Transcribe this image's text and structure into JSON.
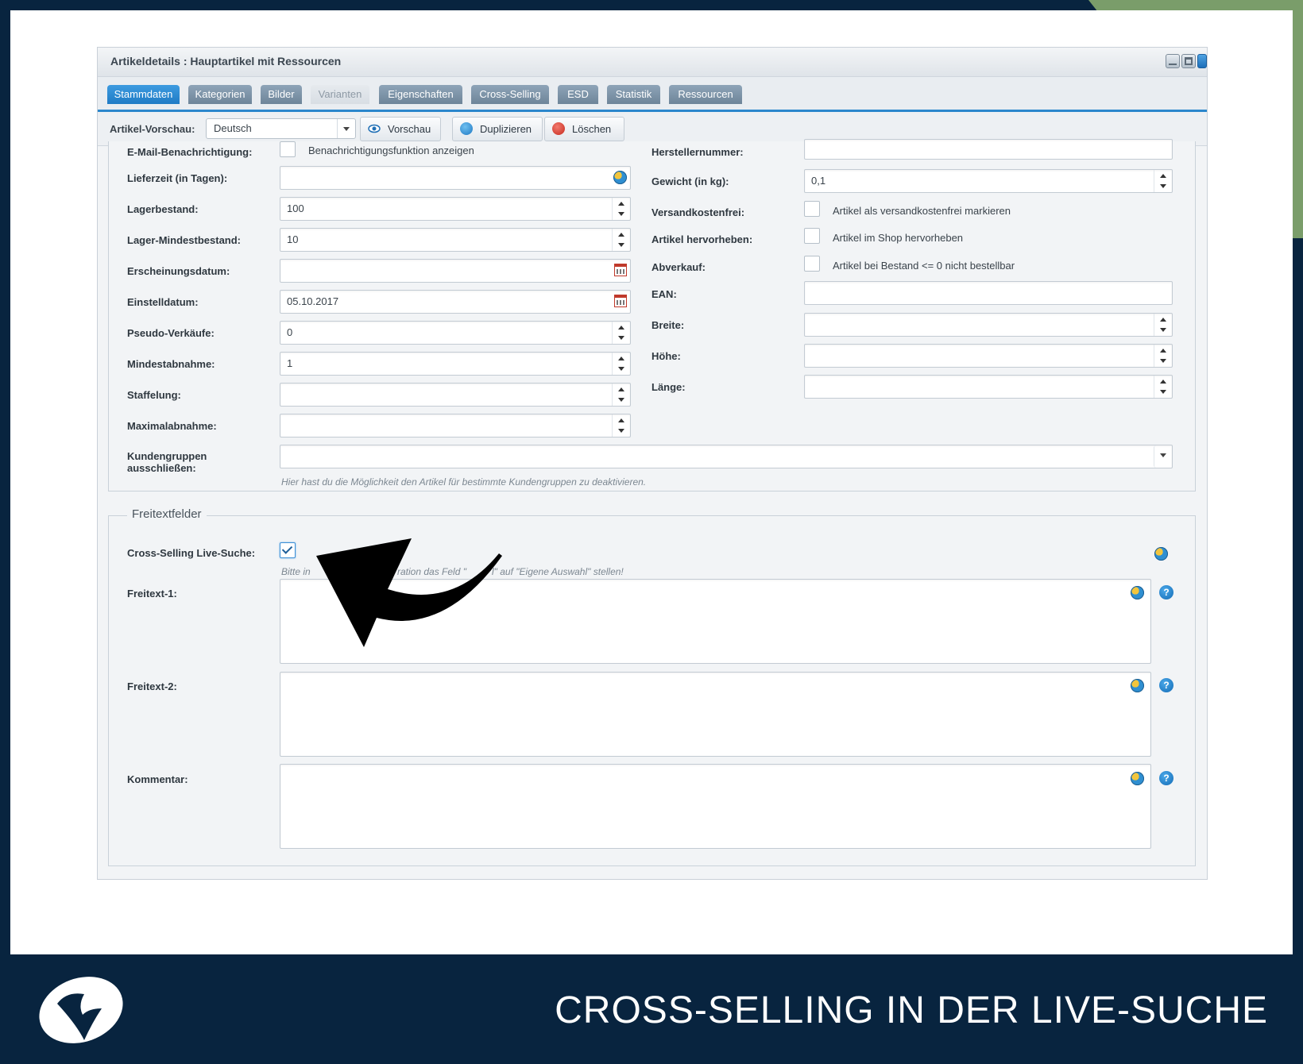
{
  "window": {
    "title": "Artikeldetails : Hauptartikel mit Ressourcen"
  },
  "tabs": [
    {
      "label": "Stammdaten",
      "state": "active"
    },
    {
      "label": "Kategorien",
      "state": "normal"
    },
    {
      "label": "Bilder",
      "state": "normal"
    },
    {
      "label": "Varianten",
      "state": "disabled"
    },
    {
      "label": "Eigenschaften",
      "state": "normal"
    },
    {
      "label": "Cross-Selling",
      "state": "normal"
    },
    {
      "label": "ESD",
      "state": "normal"
    },
    {
      "label": "Statistik",
      "state": "normal"
    },
    {
      "label": "Ressourcen",
      "state": "normal"
    }
  ],
  "toolbar": {
    "preview_label": "Artikel-Vorschau:",
    "language_value": "Deutsch",
    "preview_button": "Vorschau",
    "duplicate_button": "Duplizieren",
    "delete_button": "Löschen"
  },
  "left_fields": {
    "email_label": "E-Mail-Benachrichtigung:",
    "email_text": "Benachrichtigungsfunktion anzeigen",
    "delivery_label": "Lieferzeit (in Tagen):",
    "delivery_value": "",
    "stock_label": "Lagerbestand:",
    "stock_value": "100",
    "minstock_label": "Lager-Mindestbestand:",
    "minstock_value": "10",
    "release_label": "Erscheinungsdatum:",
    "release_value": "",
    "added_label": "Einstelldatum:",
    "added_value": "05.10.2017",
    "pseudo_label": "Pseudo-Verkäufe:",
    "pseudo_value": "0",
    "minpurchase_label": "Mindestabnahme:",
    "minpurchase_value": "1",
    "graduation_label": "Staffelung:",
    "graduation_value": "",
    "maxpurchase_label": "Maximalabnahme:",
    "maxpurchase_value": "",
    "customergroups_label_1": "Kundengruppen",
    "customergroups_label_2": "ausschließen:",
    "customergroups_hint": "Hier hast du die Möglichkeit den Artikel für bestimmte Kundengruppen zu deaktivieren."
  },
  "right_fields": {
    "manufacturer_label": "Herstellernummer:",
    "weight_label": "Gewicht (in kg):",
    "weight_value": "0,1",
    "shippingfree_label": "Versandkostenfrei:",
    "shippingfree_text": "Artikel als versandkostenfrei markieren",
    "highlight_label": "Artikel hervorheben:",
    "highlight_text": "Artikel im Shop hervorheben",
    "lastStock_label": "Abverkauf:",
    "lastStock_text": "Artikel bei Bestand <= 0 nicht bestellbar",
    "ean_label": "EAN:",
    "width_label": "Breite:",
    "height_label": "Höhe:",
    "length_label": "Länge:"
  },
  "freetext": {
    "legend": "Freitextfelder",
    "crossselling_label": "Cross-Selling Live-Suche:",
    "crossselling_hint_start": "Bitte in",
    "crossselling_hint_end": "ration das Feld \"",
    "crossselling_hint_tail": "l\" auf \"Eigene Auswahl\" stellen!",
    "freetext1_label": "Freitext-1:",
    "freetext2_label": "Freitext-2:",
    "comment_label": "Kommentar:"
  },
  "footer": {
    "title": "CROSS-SELLING IN DER LIVE-SUCHE"
  },
  "colors": {
    "background": "#08243f",
    "accent_green": "#7a9d6a",
    "tab_active": "#2b87cc"
  },
  "icons": [
    "globe-icon",
    "help-icon",
    "calendar-icon",
    "eye-icon",
    "duplicate-icon",
    "delete-icon",
    "arrow-annotation-icon",
    "brand-logo-icon"
  ]
}
